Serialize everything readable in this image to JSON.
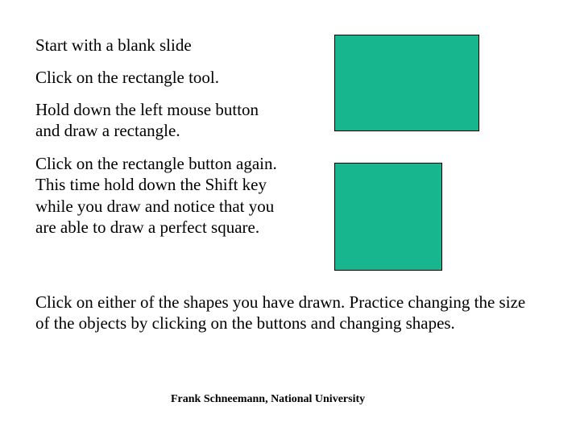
{
  "paragraphs": {
    "p1": "Start with a blank slide",
    "p2": "Click on the rectangle tool.",
    "p3": "Hold down the left mouse button and draw a rectangle.",
    "p4": "Click on the rectangle button again. This time hold down the Shift key while you draw and notice that you are able to draw a perfect square.",
    "p5": "Click on either of the shapes you have drawn. Practice changing the size of the objects by clicking on the buttons and changing shapes."
  },
  "footer": "Frank Schneemann, National University",
  "shapes": {
    "rectangle_color": "#18b68f",
    "square_color": "#18b68f"
  }
}
